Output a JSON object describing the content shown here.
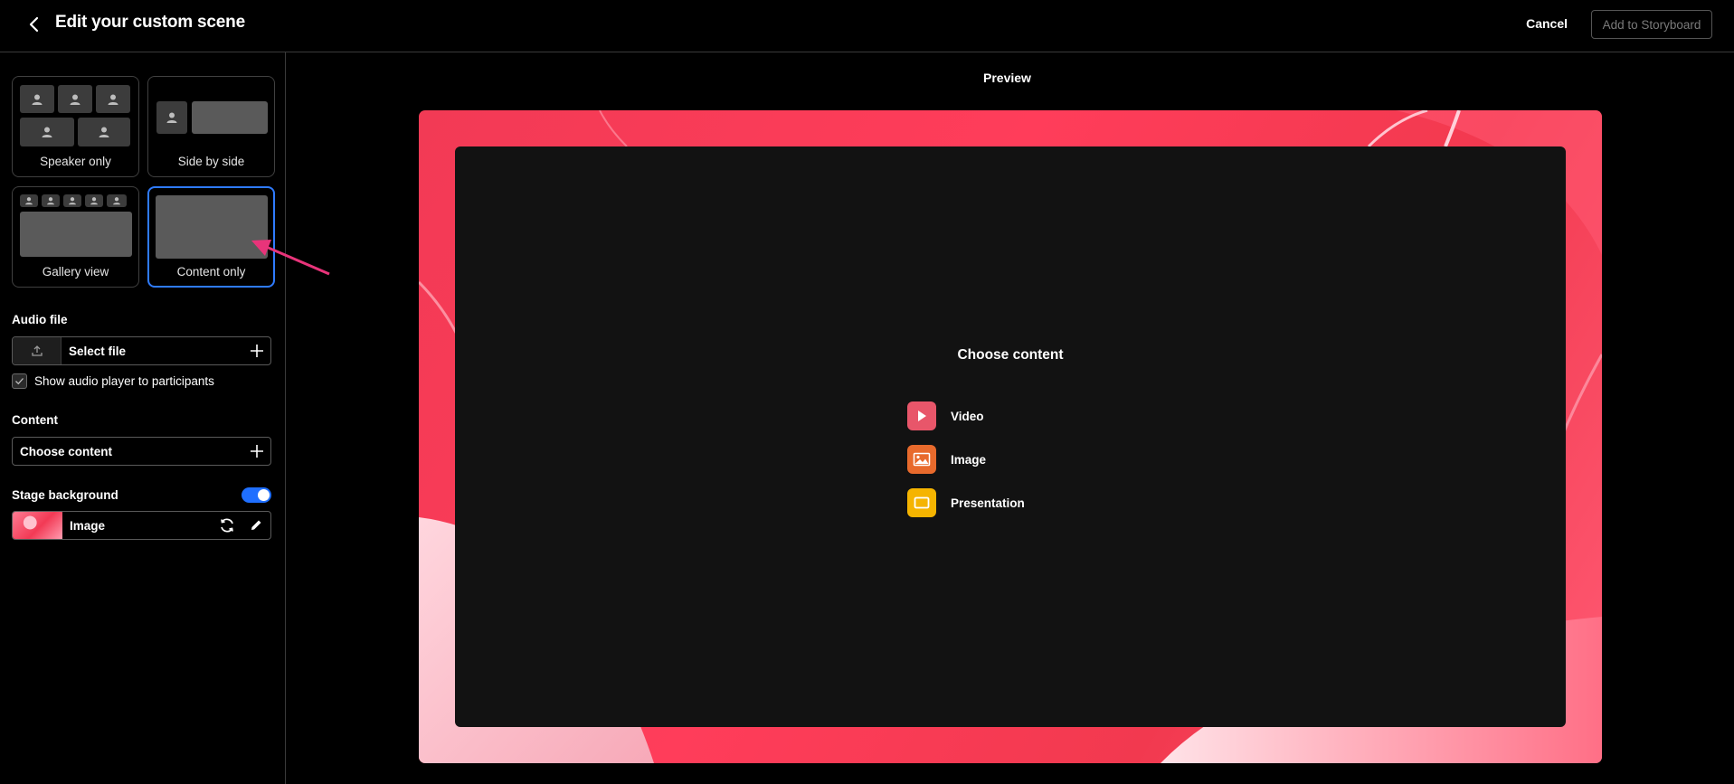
{
  "header": {
    "title": "Edit your custom scene",
    "cancel_label": "Cancel",
    "add_label": "Add to Storyboard"
  },
  "layouts": [
    {
      "label": "Speaker only",
      "selected": false
    },
    {
      "label": "Side by side",
      "selected": false
    },
    {
      "label": "Gallery view",
      "selected": false
    },
    {
      "label": "Content only",
      "selected": true
    }
  ],
  "audio": {
    "section_label": "Audio file",
    "select_label": "Select file",
    "checkbox_label": "Show audio player to participants",
    "checkbox_checked": true
  },
  "content": {
    "section_label": "Content",
    "choose_label": "Choose content"
  },
  "stage_background": {
    "section_label": "Stage background",
    "enabled": true,
    "type_label": "Image"
  },
  "preview": {
    "title": "Preview",
    "choose_title": "Choose content",
    "options": [
      {
        "label": "Video",
        "icon": "play-icon",
        "color": "#e8566a"
      },
      {
        "label": "Image",
        "icon": "image-icon",
        "color": "#e86a2c"
      },
      {
        "label": "Presentation",
        "icon": "presentation-icon",
        "color": "#f5b400"
      }
    ]
  },
  "colors": {
    "accent": "#2f7bff",
    "stage_red": "#f23a55",
    "annotation_arrow": "#e8347a"
  }
}
